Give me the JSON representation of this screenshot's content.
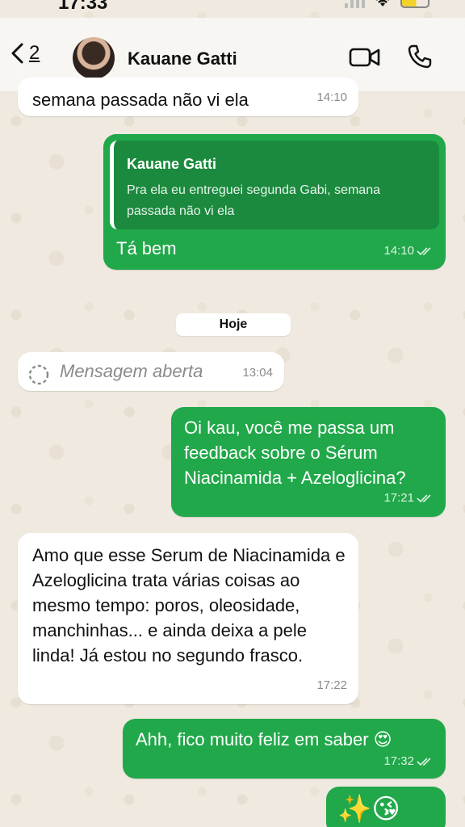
{
  "status_bar": {
    "time": "17:33"
  },
  "header": {
    "back_count": "2",
    "contact_name": "Kauane Gatti"
  },
  "messages": [
    {
      "type": "in",
      "text": "semana passada não vi ela",
      "time": "14:10"
    },
    {
      "type": "out",
      "quote": {
        "name": "Kauane Gatti",
        "text": "Pra ela eu entreguei segunda Gabi, semana passada não vi ela"
      },
      "text": "Tá bem",
      "time": "14:10"
    },
    {
      "type": "date",
      "text": "Hoje"
    },
    {
      "type": "in",
      "text": "Mensagem aberta",
      "time": "13:04"
    },
    {
      "type": "out",
      "text": "Oi kau, você me passa um feedback sobre o Sérum Niacinamida + Azeloglicina?",
      "time": "17:21"
    },
    {
      "type": "in",
      "text": "Amo que esse Serum de Niacinamida e Azeloglicina trata várias coisas ao mesmo tempo: poros, oleosidade, manchinhas... e ainda deixa a pele linda! Já estou no segundo frasco.",
      "time": "17:22"
    },
    {
      "type": "out",
      "text": "Ahh, fico muito feliz em saber 😍",
      "time": "17:32"
    },
    {
      "type": "out",
      "text": "✨😘",
      "time": ""
    }
  ],
  "colors": {
    "outgoing": "#21a84a",
    "incoming": "#ffffff",
    "wallpaper": "#efe9df"
  }
}
